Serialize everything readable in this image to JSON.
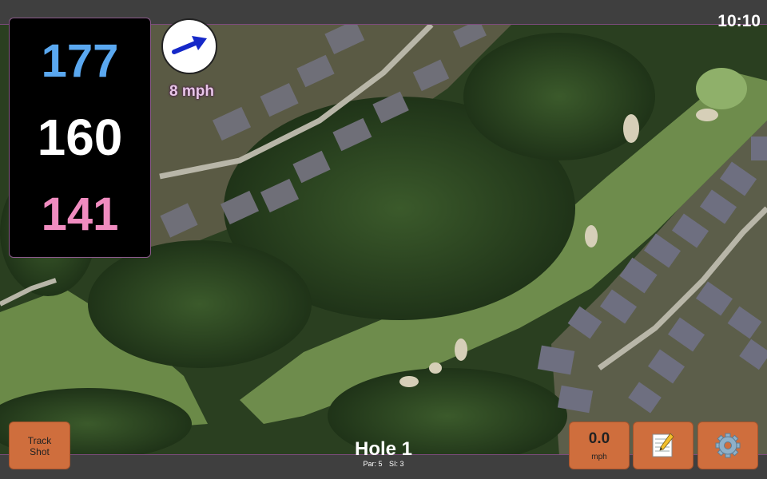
{
  "status_bar": {
    "time": "10:10"
  },
  "yardage": {
    "back": "177",
    "center": "160",
    "front": "141"
  },
  "wind": {
    "speed": "8 mph",
    "icon": "wind-arrow-icon"
  },
  "hole": {
    "title": "Hole 1",
    "par": "Par: 5",
    "si": "SI: 3"
  },
  "buttons": {
    "track_shot": [
      "Track",
      "Shot"
    ],
    "speed_value": "0.0",
    "speed_unit": "mph",
    "notes_icon": "notes-icon",
    "settings_icon": "gear-icon"
  },
  "colors": {
    "back_yardage": "#5aa8f0",
    "center_yardage": "#ffffff",
    "front_yardage": "#f08cc0",
    "button": "#cf6e3d",
    "wind_arrow": "#1528c8"
  }
}
